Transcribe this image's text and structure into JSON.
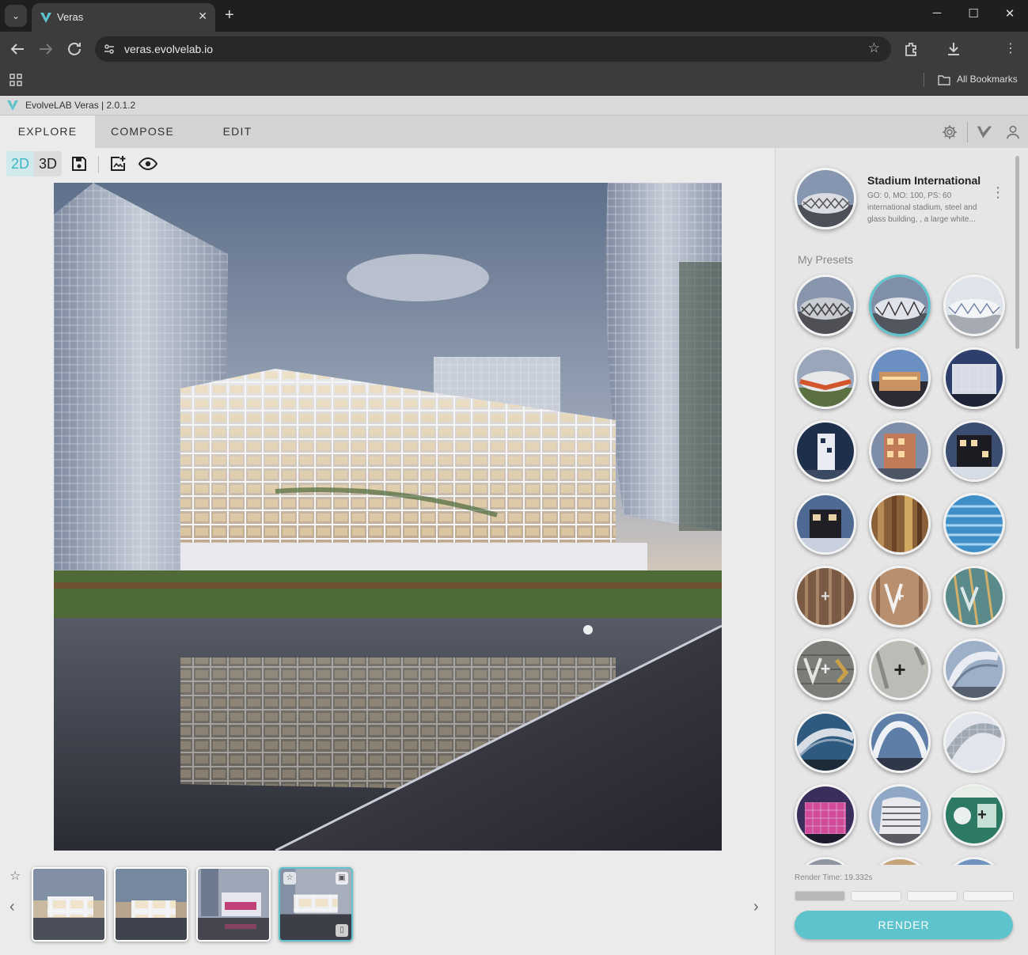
{
  "browser": {
    "tab_title": "Veras",
    "tab_close": "✕",
    "new_tab": "+",
    "url": "veras.evolvelab.io",
    "bookmarks_label": "All Bookmarks",
    "win_min": "─",
    "win_max": "☐",
    "win_close": "✕"
  },
  "app": {
    "window_title": "EvolveLAB Veras | 2.0.1.2",
    "tabs": [
      {
        "label": "EXPLORE"
      },
      {
        "label": "COMPOSE"
      },
      {
        "label": "EDIT"
      }
    ],
    "active_tab": "EXPLORE",
    "accent_color": "#5dc3cd"
  },
  "toolbar": {
    "mode_2d": "2D",
    "mode_3d": "3D",
    "active_mode": "2D"
  },
  "history": {
    "thumb_count": 4,
    "selected_index": 4
  },
  "sidebar": {
    "featured": {
      "title": "Stadium International",
      "meta": "GO: 0, MO: 100, PS: 60",
      "description": "international stadium, steel and glass building, , a large white..."
    },
    "presets_label": "My Presets",
    "presets_selected_index": 2,
    "render_time": "Render Time: 19.332s",
    "progress_segments_filled": 1,
    "progress_segments_total": 4,
    "render_button": "RENDER"
  }
}
